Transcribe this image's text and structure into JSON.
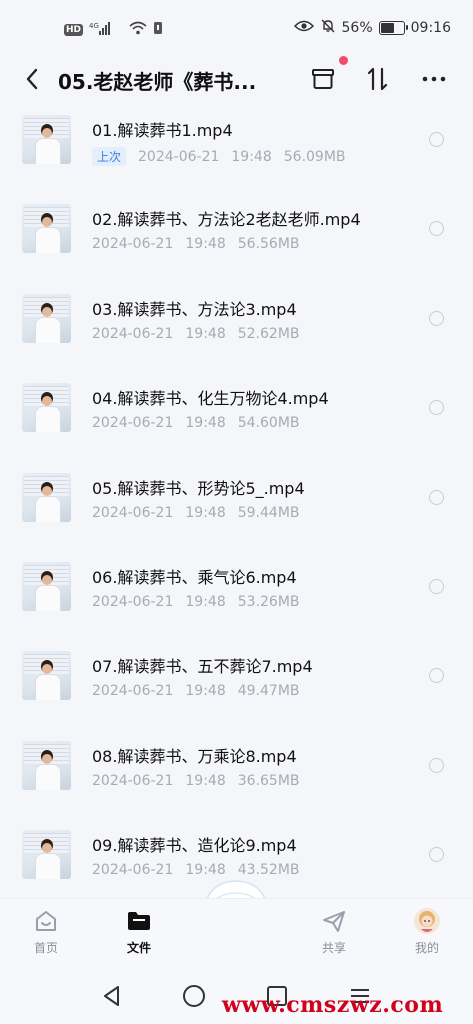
{
  "status_bar": {
    "left_badge": "HD",
    "signal": "4G",
    "battery": "56%",
    "battery_fraction": 0.56,
    "time": "09:16"
  },
  "header": {
    "title": "05.老赵老师《葬书..."
  },
  "files": [
    {
      "name": "01.解读葬书1.mp4",
      "tag": "上次",
      "date": "2024-06-21",
      "time": "19:48",
      "size": "56.09MB"
    },
    {
      "name": "02.解读葬书、方法论2老赵老师.mp4",
      "date": "2024-06-21",
      "time": "19:48",
      "size": "56.56MB"
    },
    {
      "name": "03.解读葬书、方法论3.mp4",
      "date": "2024-06-21",
      "time": "19:48",
      "size": "52.62MB"
    },
    {
      "name": "04.解读葬书、化生万物论4.mp4",
      "date": "2024-06-21",
      "time": "19:48",
      "size": "54.60MB"
    },
    {
      "name": "05.解读葬书、形势论5_.mp4",
      "date": "2024-06-21",
      "time": "19:48",
      "size": "59.44MB"
    },
    {
      "name": "06.解读葬书、乘气论6.mp4",
      "date": "2024-06-21",
      "time": "19:48",
      "size": "53.26MB"
    },
    {
      "name": "07.解读葬书、五不葬论7.mp4",
      "date": "2024-06-21",
      "time": "19:48",
      "size": "49.47MB"
    },
    {
      "name": "08.解读葬书、万乘论8.mp4",
      "date": "2024-06-21",
      "time": "19:48",
      "size": "36.65MB"
    },
    {
      "name": "09.解读葬书、造化论9.mp4",
      "date": "2024-06-21",
      "time": "19:48",
      "size": "43.52MB"
    }
  ],
  "bottom_nav": {
    "items": [
      {
        "label": "首页",
        "icon": "home-icon"
      },
      {
        "label": "文件",
        "icon": "folder-icon",
        "active": true
      },
      {
        "label": "共享",
        "icon": "share-icon"
      },
      {
        "label": "我的",
        "icon": "avatar"
      }
    ]
  },
  "watermark": "www.cmszwz.com",
  "colors": {
    "accent": "#3b7fe0",
    "notification_dot": "#f24a6a",
    "watermark": "#d0021b"
  }
}
